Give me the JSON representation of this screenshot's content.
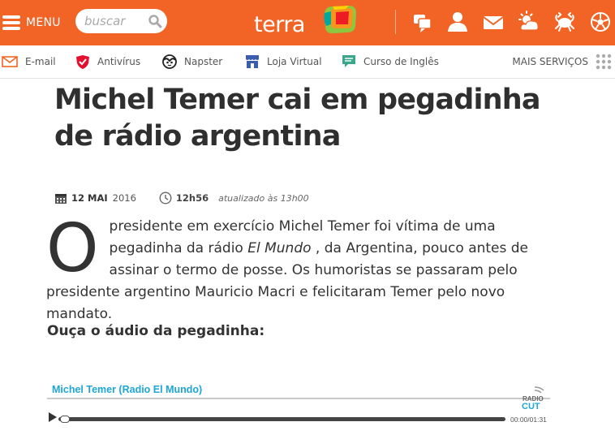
{
  "header": {
    "menu_label": "MENU",
    "search_placeholder": "buscar",
    "logo_text": "terra",
    "icons": [
      "chat-icon",
      "user-icon",
      "mail-icon",
      "weather-icon",
      "horoscope-icon",
      "soccer-icon"
    ],
    "brand_color": "#f16425"
  },
  "services": {
    "items": [
      {
        "label": "E-mail",
        "icon": "envelope-icon"
      },
      {
        "label": "Antivírus",
        "icon": "shield-icon"
      },
      {
        "label": "Napster",
        "icon": "napster-icon"
      },
      {
        "label": "Loja Virtual",
        "icon": "store-icon"
      },
      {
        "label": "Curso de Inglês",
        "icon": "speech-icon"
      }
    ],
    "more_label": "MAIS SERVIÇOS"
  },
  "article": {
    "title": "Michel Temer cai em pegadinha de rádio argentina",
    "date_day": "12 MAI",
    "date_year": "2016",
    "time": "12h56",
    "updated": "atualizado às 13h00",
    "dropcap": "O",
    "p1_a": "presidente em exercício Michel Temer foi vítima de uma pegadinha da rádio ",
    "p1_em": "El Mundo",
    "p1_b": " , da Argentina, pouco antes de assinar o termo de posse. Os humoristas se passaram pelo presidente argentino Mauricio Macri e felicitaram Temer pelo novo mandato.",
    "subheading": "Ouça o áudio da pegadinha:"
  },
  "player": {
    "title": "Michel Temer (Radio El Mundo)",
    "brand_top": "RADIO",
    "brand_bottom": "CUT",
    "time": "00:00/01:31",
    "progress": 0,
    "accent": "#1da6d7"
  }
}
